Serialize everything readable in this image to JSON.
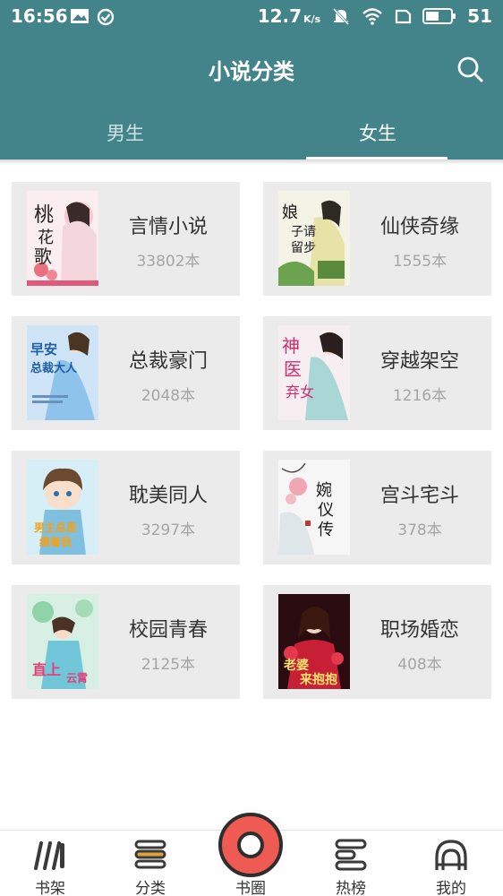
{
  "status_bar": {
    "time": "16:56",
    "speed_value": "12.7",
    "speed_unit": "K/s",
    "battery": "51"
  },
  "header": {
    "title": "小说分类",
    "tabs": [
      {
        "label": "男生",
        "active": false
      },
      {
        "label": "女生",
        "active": true
      }
    ]
  },
  "categories": [
    {
      "name": "言情小说",
      "count": "33802本",
      "cover_text": "桃花歌"
    },
    {
      "name": "仙侠奇缘",
      "count": "1555本",
      "cover_text": "娘子请留步"
    },
    {
      "name": "总裁豪门",
      "count": "2048本",
      "cover_text": "早安总裁大人"
    },
    {
      "name": "穿越架空",
      "count": "1216本",
      "cover_text": "神医弃女"
    },
    {
      "name": "耽美同人",
      "count": "3297本",
      "cover_text": "男主总是缠着我"
    },
    {
      "name": "宫斗宅斗",
      "count": "378本",
      "cover_text": "婉仪传"
    },
    {
      "name": "校园青春",
      "count": "2125本",
      "cover_text": "直上云霄"
    },
    {
      "name": "职场婚恋",
      "count": "408本",
      "cover_text": "老婆大人来抱抱"
    }
  ],
  "bottom_nav": [
    {
      "label": "书架",
      "icon": "bookshelf-icon"
    },
    {
      "label": "分类",
      "icon": "category-icon",
      "active": true
    },
    {
      "label": "书圈",
      "icon": "book-circle-icon"
    },
    {
      "label": "热榜",
      "icon": "hot-list-icon"
    },
    {
      "label": "我的",
      "icon": "profile-icon"
    }
  ],
  "colors": {
    "header": "#43848b",
    "card_bg": "#ebebeb",
    "accent": "#ef5a52"
  }
}
